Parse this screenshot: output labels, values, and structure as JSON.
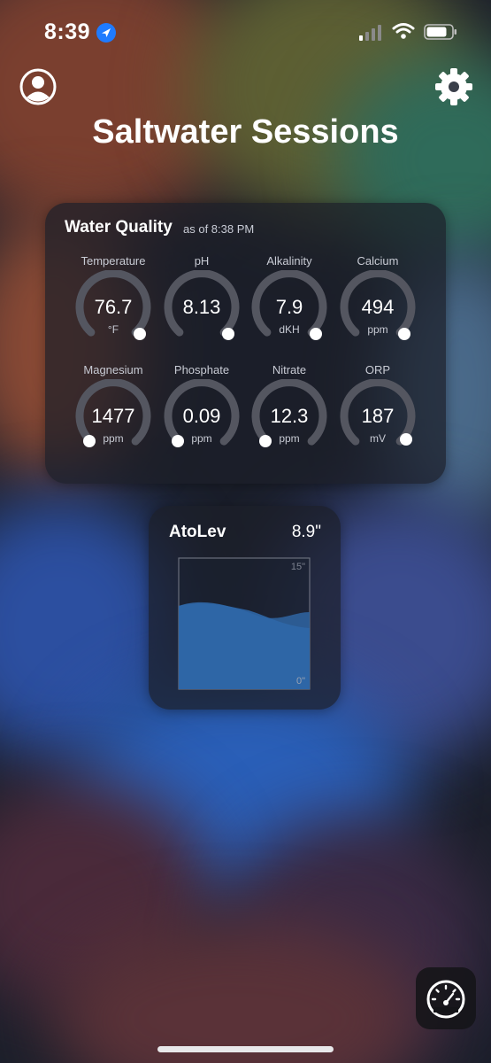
{
  "status_bar": {
    "time": "8:39"
  },
  "header": {
    "title": "Saltwater Sessions"
  },
  "water_quality": {
    "title": "Water Quality",
    "updated": "as of 8:38 PM",
    "gauges": [
      {
        "label": "Temperature",
        "value": "76.7",
        "unit": "°F"
      },
      {
        "label": "pH",
        "value": "8.13",
        "unit": ""
      },
      {
        "label": "Alkalinity",
        "value": "7.9",
        "unit": "dKH"
      },
      {
        "label": "Calcium",
        "value": "494",
        "unit": "ppm"
      },
      {
        "label": "Magnesium",
        "value": "1477",
        "unit": "ppm"
      },
      {
        "label": "Phosphate",
        "value": "0.09",
        "unit": "ppm"
      },
      {
        "label": "Nitrate",
        "value": "12.3",
        "unit": "ppm"
      },
      {
        "label": "ORP",
        "value": "187",
        "unit": "mV"
      }
    ]
  },
  "atolev": {
    "title": "AtoLev",
    "level": "8.9\"",
    "scale_top": "15\"",
    "scale_bottom": "0\""
  },
  "colors": {
    "accent_blue": "#1f7bff",
    "fill_blue": "#2f6aa8"
  }
}
